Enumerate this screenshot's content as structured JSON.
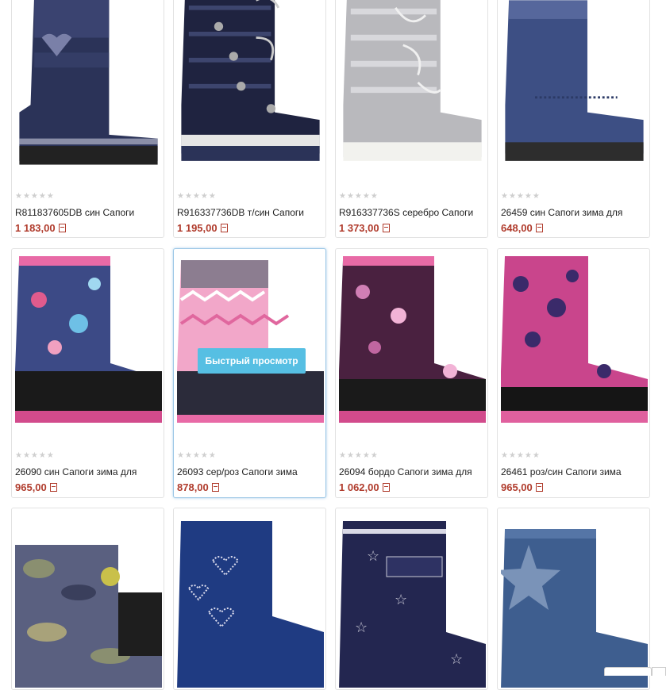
{
  "products": [
    {
      "name": "R811837605DB син Сапоги",
      "price": "1 183,00",
      "stars": "★★★★★"
    },
    {
      "name": "R916337736DB т/син Сапоги",
      "price": "1 195,00",
      "stars": "★★★★★"
    },
    {
      "name": "R916337736S серебро Сапоги",
      "price": "1 373,00",
      "stars": "★★★★★"
    },
    {
      "name": "26459 син Сапоги зима для",
      "price": "648,00",
      "stars": "★★★★★"
    },
    {
      "name": "26090 син Сапоги зима для",
      "price": "965,00",
      "stars": "★★★★★"
    },
    {
      "name": "26093 сер/роз Сапоги зима",
      "price": "878,00",
      "stars": "★★★★★"
    },
    {
      "name": "26094 бордо Сапоги зима для",
      "price": "1 062,00",
      "stars": "★★★★★"
    },
    {
      "name": "26461 роз/син Сапоги зима",
      "price": "965,00",
      "stars": "★★★★★"
    },
    {
      "name": "",
      "price": "",
      "stars": ""
    },
    {
      "name": "",
      "price": "",
      "stars": ""
    },
    {
      "name": "",
      "price": "",
      "stars": ""
    },
    {
      "name": "",
      "price": "",
      "stars": ""
    }
  ],
  "quick_view_label": "Быстрый просмотр",
  "colors": {
    "price": "#b03b2c",
    "quick_view_bg": "#56bfe3",
    "active_border": "#9cc7e6"
  }
}
